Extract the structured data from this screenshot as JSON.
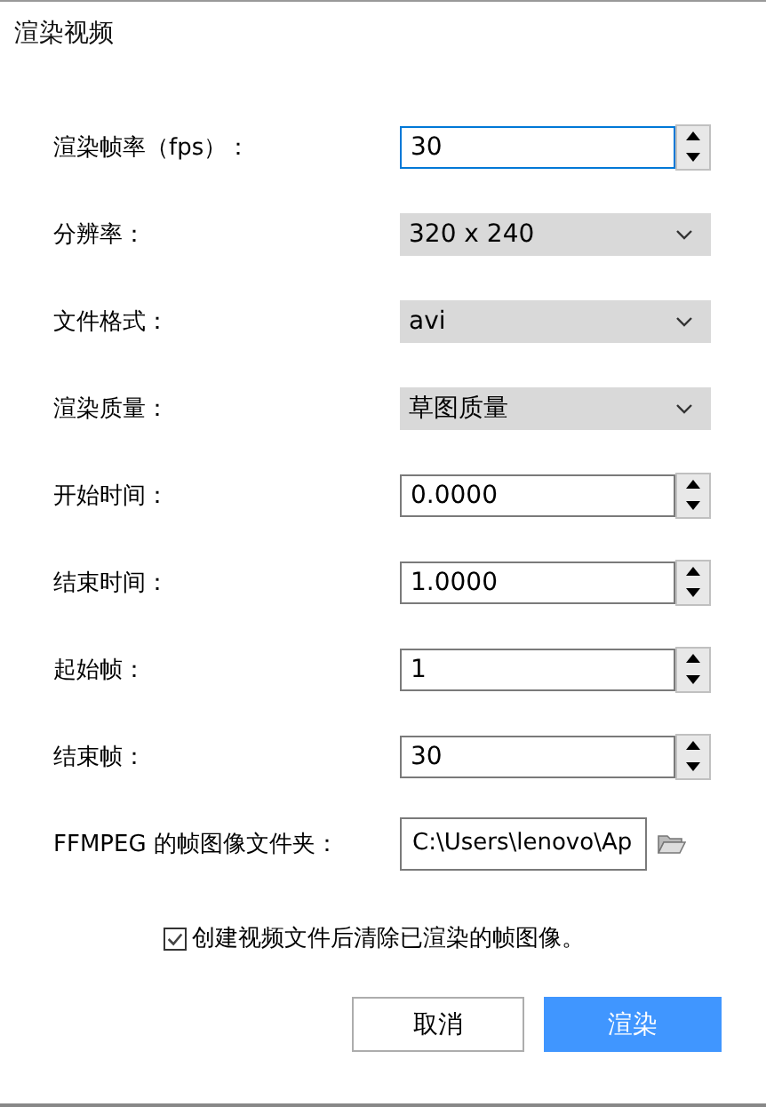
{
  "window": {
    "title": "渲染视频"
  },
  "fields": [
    {
      "kind": "spin",
      "label": "渲染帧率（fps）：",
      "value": "30",
      "focused": true
    },
    {
      "kind": "select",
      "label": "分辨率：",
      "value": "320 x 240"
    },
    {
      "kind": "select",
      "label": "文件格式：",
      "value": "avi"
    },
    {
      "kind": "select",
      "label": "渲染质量：",
      "value": "草图质量"
    },
    {
      "kind": "spin",
      "label": "开始时间：",
      "value": "0.0000",
      "focused": false
    },
    {
      "kind": "spin",
      "label": "结束时间：",
      "value": "1.0000",
      "focused": false
    },
    {
      "kind": "spin",
      "label": "起始帧：",
      "value": "1",
      "focused": false
    },
    {
      "kind": "spin",
      "label": "结束帧：",
      "value": "30",
      "focused": false
    },
    {
      "kind": "path",
      "label": "FFMPEG 的帧图像文件夹：",
      "value": "C:\\Users\\lenovo\\Ap"
    }
  ],
  "option": {
    "label": "创建视频文件后清除已渲染的帧图像。",
    "checked": true
  },
  "buttons": [
    {
      "label": "取消",
      "kind": "secondary"
    },
    {
      "label": "渲染",
      "kind": "primary"
    }
  ]
}
